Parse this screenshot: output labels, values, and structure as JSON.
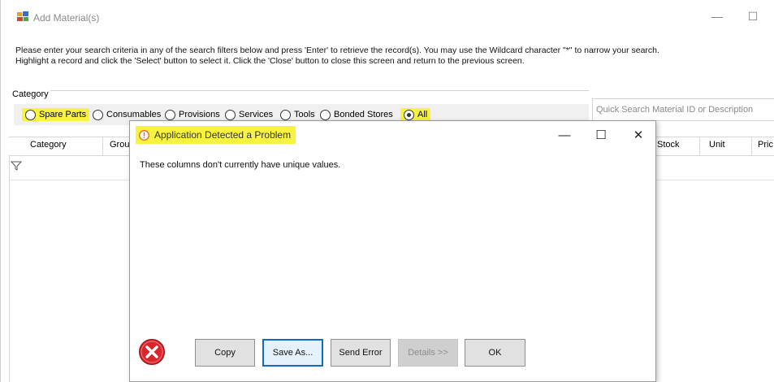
{
  "window": {
    "title": "Add Material(s)",
    "icon": "app-material-icon",
    "minimize_glyph": "—",
    "maximize_glyph": "☐"
  },
  "instructions": {
    "line1": "Please enter your search criteria in any of the search filters below and press 'Enter' to retrieve the record(s). You may use the Wildcard character \"*\" to narrow your search.",
    "line2": "Highlight a record and click the 'Select' button to select it. Click the 'Close' button to close this screen and return to the previous screen."
  },
  "category": {
    "label": "Category",
    "options": [
      {
        "label": "Spare Parts",
        "checked": false,
        "highlighted": true
      },
      {
        "label": "Consumables",
        "checked": false,
        "highlighted": false
      },
      {
        "label": "Provisions",
        "checked": false,
        "highlighted": false
      },
      {
        "label": "Services",
        "checked": false,
        "highlighted": false
      },
      {
        "label": "Tools",
        "checked": false,
        "highlighted": false
      },
      {
        "label": "Bonded Stores",
        "checked": false,
        "highlighted": false
      },
      {
        "label": "All",
        "checked": true,
        "highlighted": true
      }
    ]
  },
  "search": {
    "placeholder": "Quick Search Material ID or Description"
  },
  "grid": {
    "columns": [
      "Category",
      "Grou",
      "Stock",
      "Unit",
      "Pric"
    ]
  },
  "dialog": {
    "title": "Application Detected a Problem",
    "message": "These columns don't currently have unique values.",
    "minimize_glyph": "—",
    "maximize_glyph": "☐",
    "close_glyph": "✕",
    "buttons": {
      "copy": "Copy",
      "save_as": "Save As...",
      "send_error": "Send Error",
      "details": "Details >>",
      "ok": "OK"
    }
  },
  "colors": {
    "highlight": "#f7f33f",
    "focus_border": "#0f6ac9",
    "error_red": "#d9252b",
    "warning_orange": "#e8641b"
  }
}
